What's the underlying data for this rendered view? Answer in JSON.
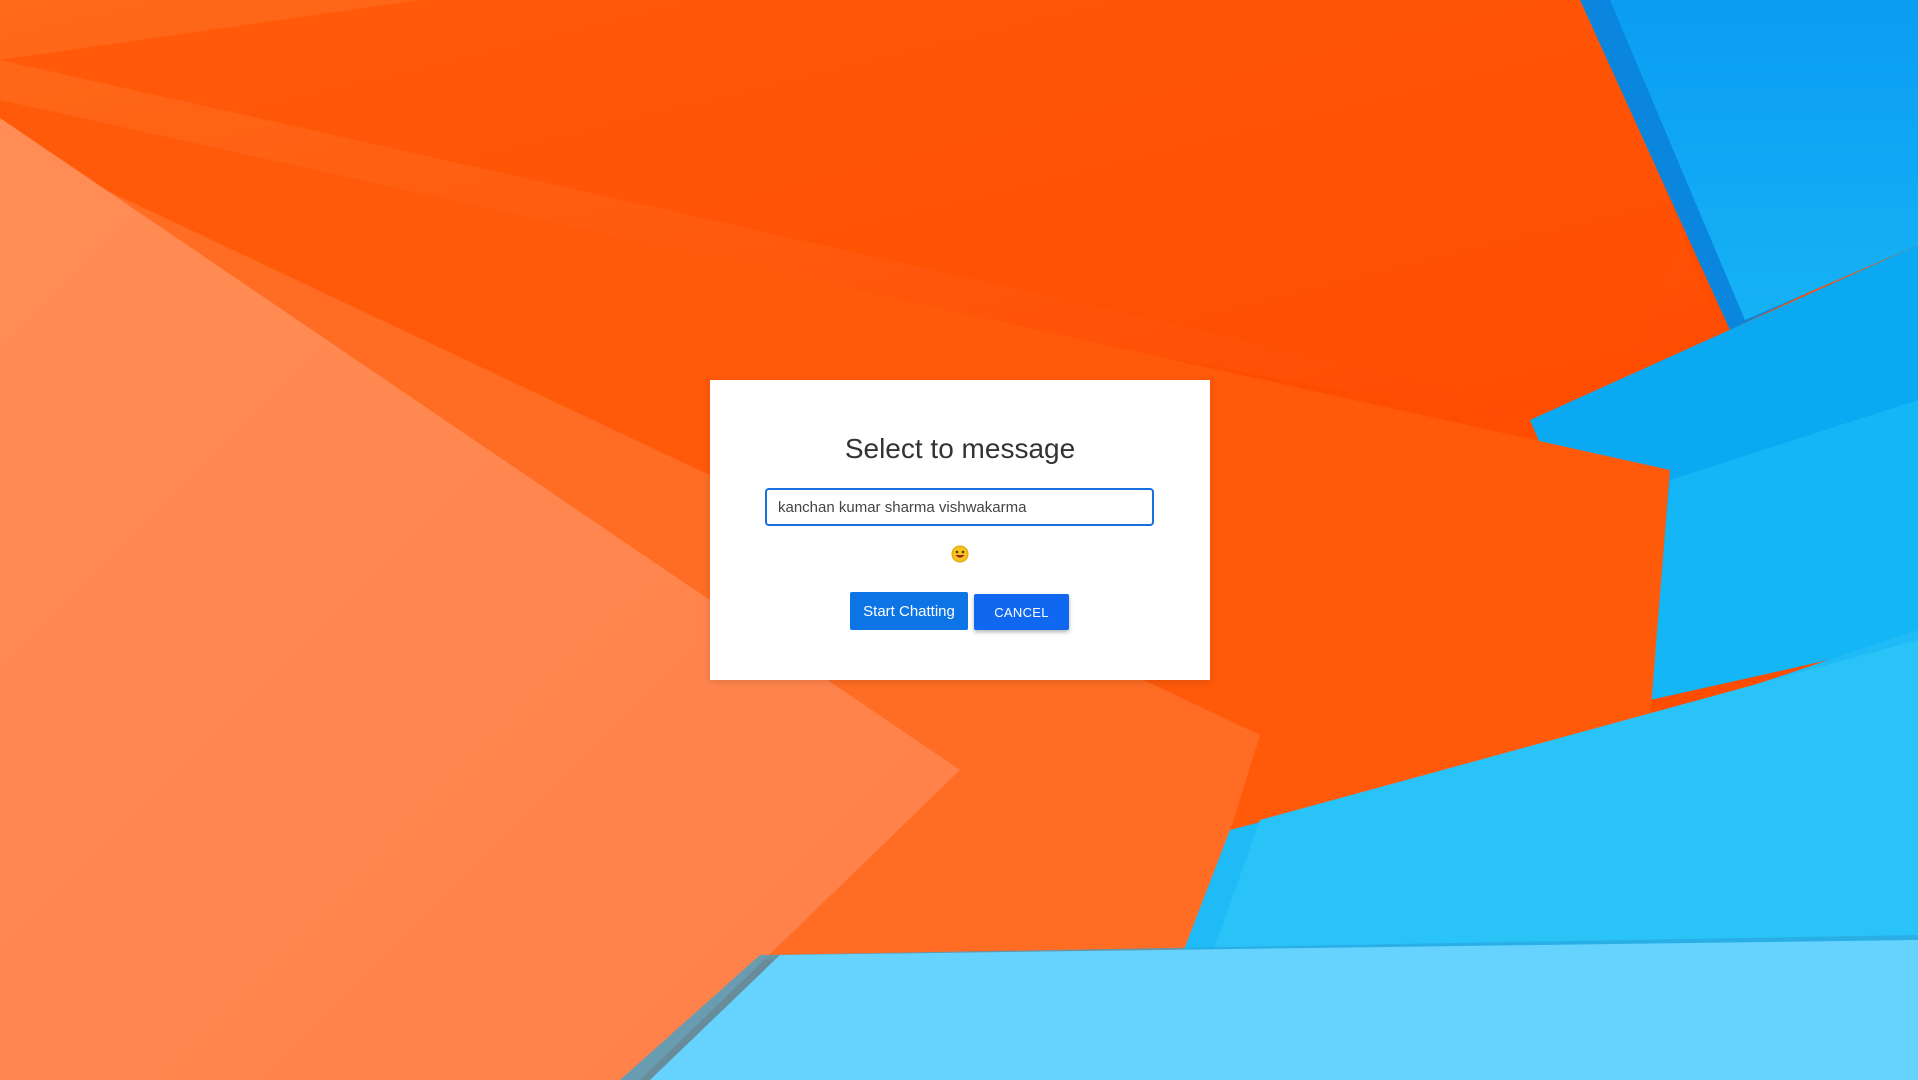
{
  "dialog": {
    "title": "Select to message",
    "input_value": "kanchan kumar sharma vishwakarma",
    "emoji_icon": "smiling-face-emoji-icon",
    "start_button_label": "Start Chatting",
    "cancel_button_label": "CANCEL"
  },
  "colors": {
    "primary_button": "#0d74e6",
    "cancel_button": "#1168f0",
    "input_border": "#1a6fe0",
    "wallpaper_orange": "#ff5a10",
    "wallpaper_blue": "#1ab8f5"
  }
}
